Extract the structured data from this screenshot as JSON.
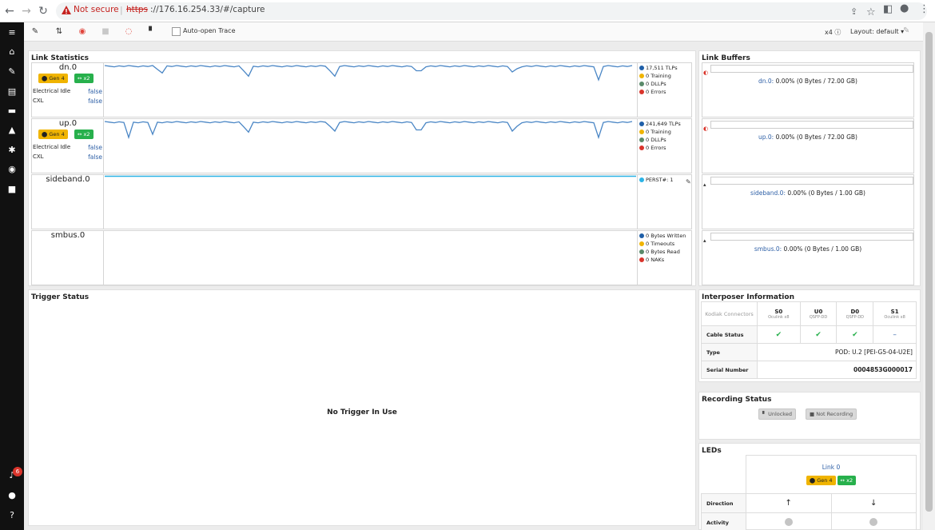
{
  "browser": {
    "not_secure": "Not secure",
    "url_scheme": "https",
    "url_rest": "://176.16.254.33/#/capture"
  },
  "toolbar": {
    "auto_open_trace": "Auto-open Trace",
    "x4": "x4",
    "layout": "Layout: default"
  },
  "sidebar": {
    "notification_count": "6"
  },
  "link_statistics": {
    "title": "Link Statistics",
    "rows": [
      {
        "name": "dn.0",
        "gen": "Gen 4",
        "lanes": "x2",
        "electrical_idle_label": "Electrical Idle",
        "electrical_idle": "false",
        "cxl_label": "CXL",
        "cxl": "false",
        "legend": [
          "17,511 TLPs",
          "0 Training",
          "0 DLLPs",
          "0 Errors"
        ]
      },
      {
        "name": "up.0",
        "gen": "Gen 4",
        "lanes": "x2",
        "electrical_idle_label": "Electrical Idle",
        "electrical_idle": "false",
        "cxl_label": "CXL",
        "cxl": "false",
        "legend": [
          "241,649 TLPs",
          "0 Training",
          "0 DLLPs",
          "0 Errors"
        ]
      },
      {
        "name": "sideband.0",
        "legend": [
          "PERST#: 1"
        ]
      },
      {
        "name": "smbus.0",
        "legend": [
          "0 Bytes Written",
          "0 Timeouts",
          "0 Bytes Read",
          "0 NAKs"
        ]
      }
    ],
    "legend_colors": {
      "blue": "#1f5fa8",
      "yellow": "#f0b400",
      "green": "#5a8a6a",
      "red": "#d9342b",
      "cyan": "#2bb3e6"
    }
  },
  "link_buffers": {
    "title": "Link Buffers",
    "items": [
      {
        "name": "dn.0:",
        "text": " 0.00% (0 Bytes / 72.00 GB)"
      },
      {
        "name": "up.0:",
        "text": " 0.00% (0 Bytes / 72.00 GB)"
      },
      {
        "name": "sideband.0:",
        "text": " 0.00% (0 Bytes / 1.00 GB)"
      },
      {
        "name": "smbus.0:",
        "text": " 0.00% (0 Bytes / 1.00 GB)"
      }
    ]
  },
  "trigger_status": {
    "title": "Trigger Status",
    "message": "No Trigger In Use"
  },
  "interposer": {
    "title": "Interposer Information",
    "connectors_label": "Kodiak Connectors",
    "connectors": [
      {
        "name": "S0",
        "sub": "Oculink x8",
        "cable": "ok"
      },
      {
        "name": "U0",
        "sub": "QSFP-DD",
        "cable": "ok"
      },
      {
        "name": "D0",
        "sub": "QSFP-DD",
        "cable": "ok"
      },
      {
        "name": "S1",
        "sub": "Oculink x8",
        "cable": "none"
      }
    ],
    "cable_status_label": "Cable Status",
    "type_label": "Type",
    "type_value": "POD: U.2 [PEI-G5-04-U2E]",
    "serial_label": "Serial Number",
    "serial_value": "0004853G000017"
  },
  "recording": {
    "title": "Recording Status",
    "unlocked": "Unlocked",
    "not_recording": "Not Recording"
  },
  "leds": {
    "title": "LEDs",
    "link": "Link 0",
    "gen": "Gen 4",
    "lanes": "x2",
    "direction_label": "Direction",
    "activity_label": "Activity",
    "dir_up": "↑",
    "dir_down": "↓"
  }
}
